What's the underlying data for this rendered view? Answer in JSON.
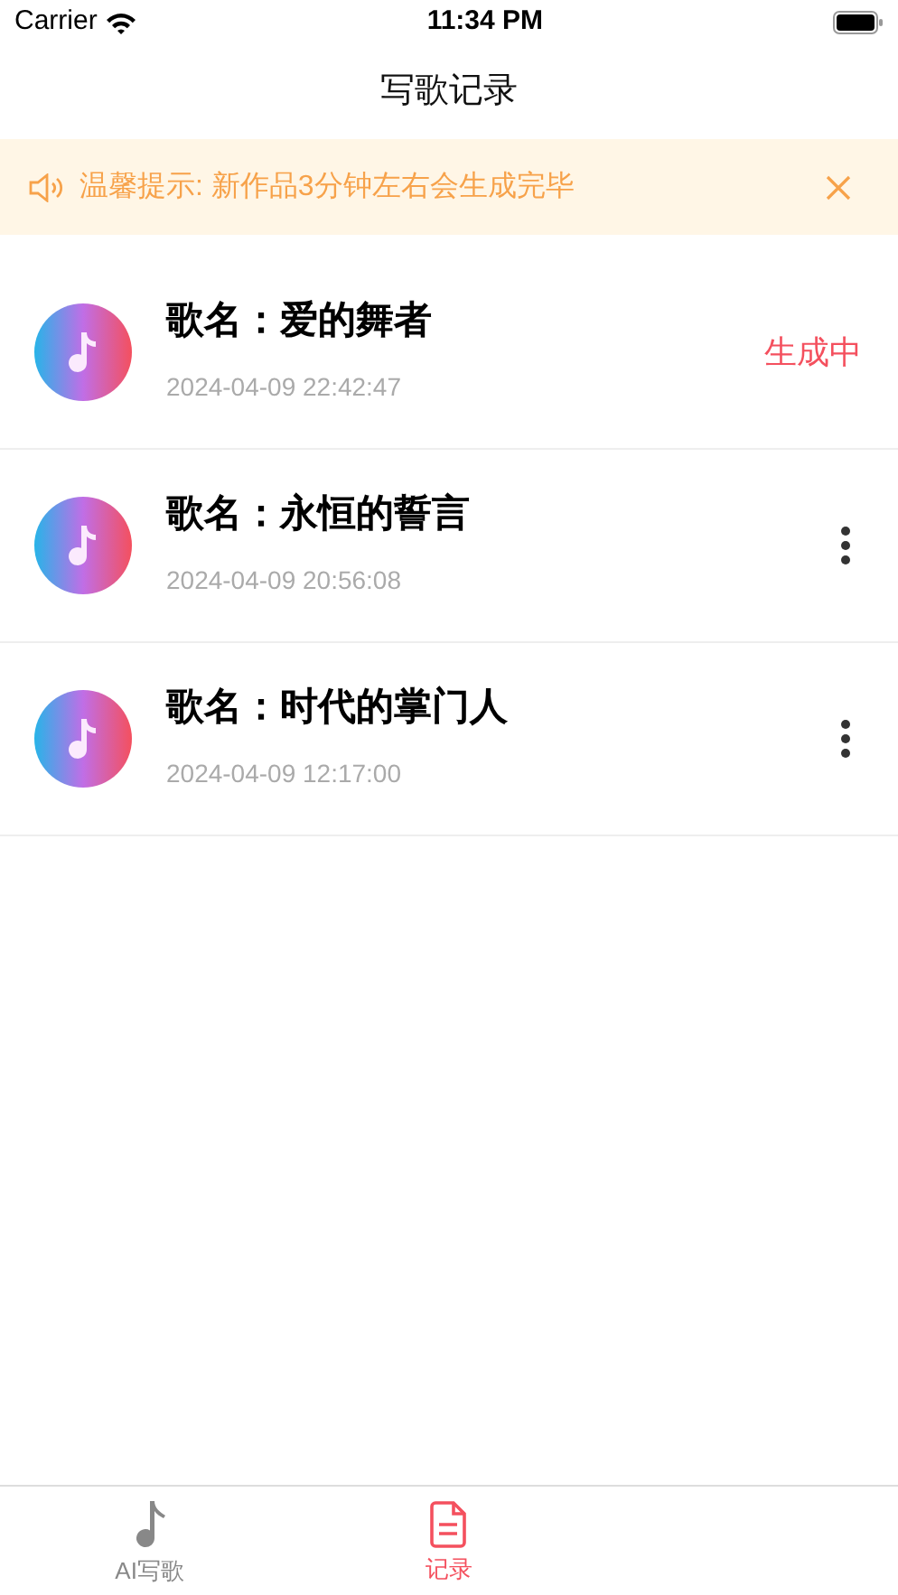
{
  "status_bar": {
    "carrier": "Carrier",
    "time": "11:34 PM"
  },
  "nav": {
    "title": "写歌记录"
  },
  "notice": {
    "text": "温馨提示: 新作品3分钟左右会生成完毕"
  },
  "records": [
    {
      "title": "歌名：爱的舞者",
      "time": "2024-04-09 22:42:47",
      "kind": "generating",
      "status": "生成中"
    },
    {
      "title": "歌名：永恒的誓言",
      "time": "2024-04-09 20:56:08",
      "kind": "done"
    },
    {
      "title": "歌名：时代的掌门人",
      "time": "2024-04-09 12:17:00",
      "kind": "done"
    }
  ],
  "tabs": [
    {
      "label": "AI写歌",
      "kind": "write",
      "selected": false
    },
    {
      "label": "记录",
      "kind": "records",
      "selected": true
    }
  ]
}
